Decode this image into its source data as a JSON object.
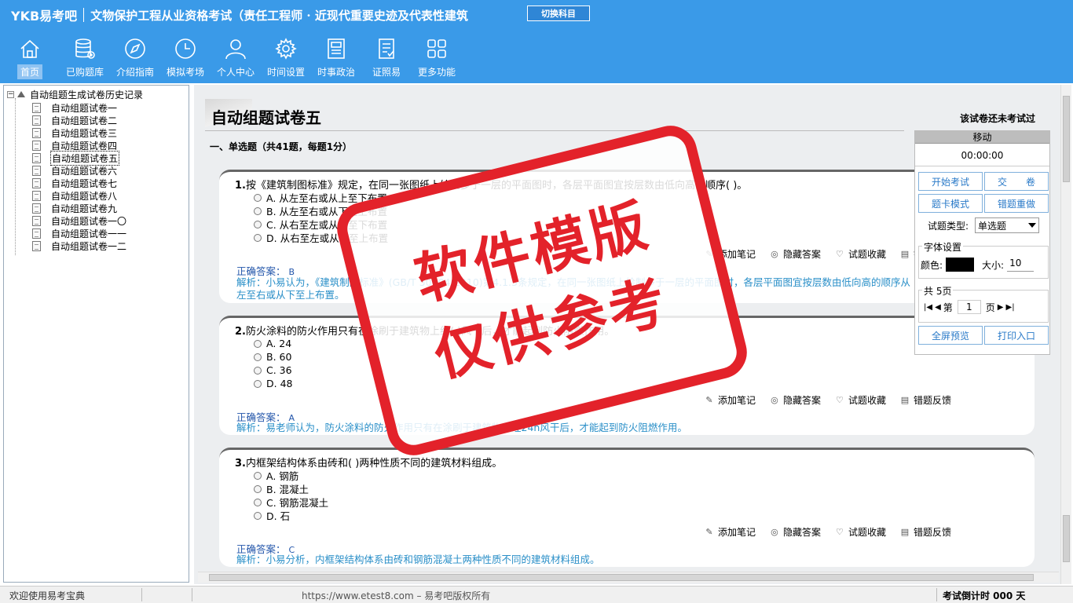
{
  "header": {
    "logo": "YKB易考吧",
    "subject": "文物保护工程从业资格考试（责任工程师 · 近现代重要史迹及代表性建筑",
    "switch_label": "切换科目",
    "nav": [
      {
        "label": "首页",
        "icon": "home-icon"
      },
      {
        "label": "已购题库",
        "icon": "database-icon"
      },
      {
        "label": "介绍指南",
        "icon": "compass-icon"
      },
      {
        "label": "模拟考场",
        "icon": "clock-icon"
      },
      {
        "label": "个人中心",
        "icon": "user-icon"
      },
      {
        "label": "时间设置",
        "icon": "gear-icon"
      },
      {
        "label": "时事政治",
        "icon": "newspaper-icon"
      },
      {
        "label": "证照易",
        "icon": "certificate-icon"
      },
      {
        "label": "更多功能",
        "icon": "grid-icon"
      }
    ]
  },
  "tree": {
    "root": "自动组题生成试卷历史记录",
    "items": [
      "自动组题试卷一",
      "自动组题试卷二",
      "自动组题试卷三",
      "自动组题试卷四",
      "自动组题试卷五",
      "自动组题试卷六",
      "自动组题试卷七",
      "自动组题试卷八",
      "自动组题试卷九",
      "自动组题试卷一〇",
      "自动组题试卷一一",
      "自动组题试卷一二"
    ],
    "selected_index": 4
  },
  "paper": {
    "title": "自动组题试卷五",
    "status": "该试卷还未考试过",
    "section": "一、单选题（共41题，每题1分）"
  },
  "tools": {
    "note": "添加笔记",
    "hide": "隐藏答案",
    "fav": "试题收藏",
    "report": "错题反馈"
  },
  "questions": [
    {
      "num": "1.",
      "stem": "按《建筑制图标准》规定，在同一张图纸上绘制多于一层的平面图时，各层平面图宜按层数由低向高的顺序( )。",
      "options": [
        "A. 从左至右或从上至下布置",
        "B. 从左至右或从下至上布置",
        "C. 从右至左或从上至下布置",
        "D. 从右至左或从下至上布置"
      ],
      "answer_label": "正确答案：",
      "answer": "B",
      "analysis": "解析：小易认为，《建筑制图标准》(GB/T 50104-2010)第4.1.3条规定，在同一张图纸上绘制多于一层的平面图时，各层平面图宜按层数由低向高的顺序从左至右或从下至上布置。"
    },
    {
      "num": "2.",
      "stem": "防火涂料的防火作用只有在涂刷于建筑物上经( )风干后，才能起到防火阻燃作用。",
      "options": [
        "A. 24",
        "B. 60",
        "C. 36",
        "D. 48"
      ],
      "answer_label": "正确答案：",
      "answer": "A",
      "analysis": "解析：易老师认为，防火涂料的防火作用只有在涂刷于建筑物上经24h风干后，才能起到防火阻燃作用。"
    },
    {
      "num": "3.",
      "stem": "内框架结构体系由砖和( )两种性质不同的建筑材料组成。",
      "options": [
        "A. 钢筋",
        "B. 混凝土",
        "C. 钢筋混凝土",
        "D. 石"
      ],
      "answer_label": "正确答案：",
      "answer": "C",
      "analysis": "解析：小易分析，内框架结构体系由砖和钢筋混凝土两种性质不同的建筑材料组成。"
    }
  ],
  "control": {
    "move": "移动",
    "timer": "00:00:00",
    "start": "开始考试",
    "submit": "交　　卷",
    "card_mode": "题卡模式",
    "redo": "错题重做",
    "type_label": "试题类型:",
    "type_value": "单选题",
    "font_legend": "字体设置",
    "color_label": "颜色:",
    "color_value": "#000000",
    "size_label": "大小:",
    "size_value": "10",
    "pages_legend": "共 5页",
    "page_prefix": "第",
    "page_value": "1",
    "page_suffix": "页",
    "fullscreen": "全屏预览",
    "print": "打印入口"
  },
  "status": {
    "welcome": "欢迎使用易考宝典",
    "copyright": "https://www.etest8.com – 易考吧版权所有",
    "countdown": "考试倒计时 000 天"
  },
  "watermark": [
    "软件模版",
    "仅供参考"
  ],
  "colors": {
    "header": "#3a9ae8",
    "watermark": "#e3222a",
    "answer": "#2255aa",
    "analysis": "#2a8fc8"
  }
}
